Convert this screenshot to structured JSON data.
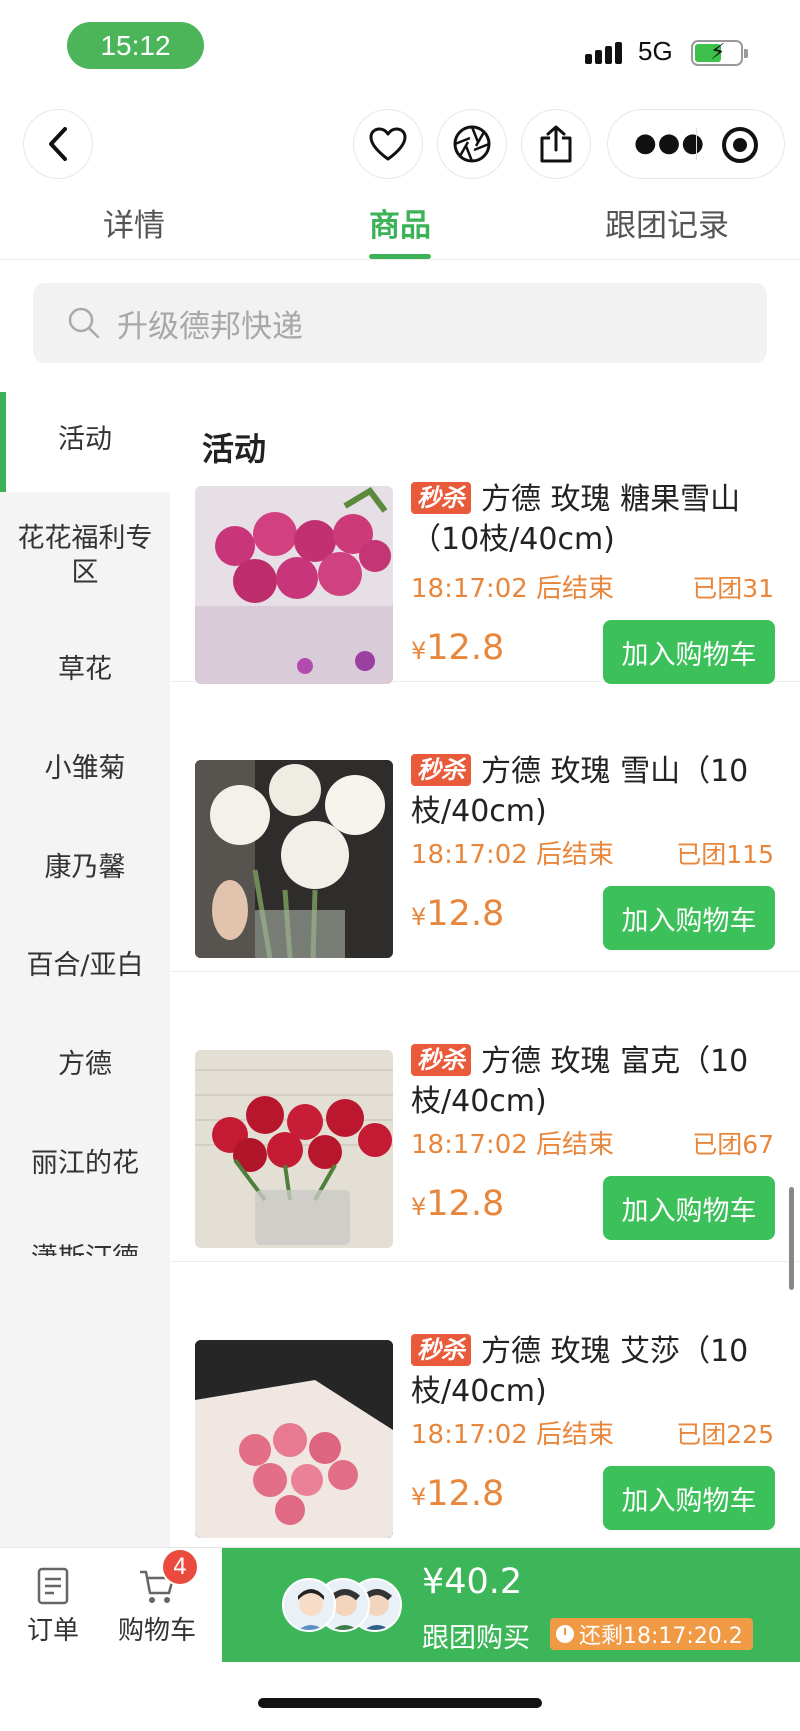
{
  "status_bar": {
    "time": "15:12",
    "network": "5G"
  },
  "nav": {
    "icons": [
      "back-icon",
      "heart-icon",
      "shutter-icon",
      "share-icon",
      "more-icon",
      "target-icon"
    ]
  },
  "tabs": [
    {
      "label": "详情"
    },
    {
      "label": "商品"
    },
    {
      "label": "跟团记录"
    }
  ],
  "search": {
    "placeholder": "升级德邦快递"
  },
  "sidebar": {
    "items": [
      {
        "label": "活动"
      },
      {
        "label": "花花福利专区"
      },
      {
        "label": "草花"
      },
      {
        "label": "小雏菊"
      },
      {
        "label": "康乃馨"
      },
      {
        "label": "百合/亚白"
      },
      {
        "label": "方德"
      },
      {
        "label": "丽江的花"
      },
      {
        "label": "潇斯汀德"
      }
    ],
    "active": "活动"
  },
  "main": {
    "section_title": "活动",
    "products": [
      {
        "badge": "秒杀",
        "name": "方德 玫瑰 糖果雪山（10枝/40cm)",
        "countdown": "18:17:02 后结束",
        "joined": "已团31",
        "currency": "¥",
        "price": "12.8",
        "button": "加入购物车",
        "image_colors": [
          "#c8357a",
          "#e2b7c8",
          "#5c8a3d"
        ]
      },
      {
        "badge": "秒杀",
        "name": "方德 玫瑰 雪山（10枝/40cm)",
        "countdown": "18:17:02 后结束",
        "joined": "已团115",
        "currency": "¥",
        "price": "12.8",
        "button": "加入购物车",
        "image_colors": [
          "#f4f1ea",
          "#2a2a2a",
          "#6e8a55"
        ]
      },
      {
        "badge": "秒杀",
        "name": "方德 玫瑰 富克（10枝/40cm)",
        "countdown": "18:17:02 后结束",
        "joined": "已团67",
        "currency": "¥",
        "price": "12.8",
        "button": "加入购物车",
        "image_colors": [
          "#c41a33",
          "#e7e2d8",
          "#4f7f3b"
        ]
      },
      {
        "badge": "秒杀",
        "name": "方德 玫瑰 艾莎（10枝/40cm)",
        "countdown": "18:17:02 后结束",
        "joined": "已团225",
        "currency": "¥",
        "price": "12.8",
        "button": "加入购物车",
        "image_colors": [
          "#e36f86",
          "#f0e6e2",
          "#2b2b2b"
        ]
      }
    ]
  },
  "bottom_bar": {
    "order_label": "订单",
    "cart_label": "购物车",
    "cart_count": "4",
    "group_price": "¥40.2",
    "group_label": "跟团购买",
    "remain": "还剩18:17:20.2"
  },
  "colors": {
    "accent": "#3bb257",
    "orange": "#e8873c",
    "badge_red": "#e85a3a"
  }
}
